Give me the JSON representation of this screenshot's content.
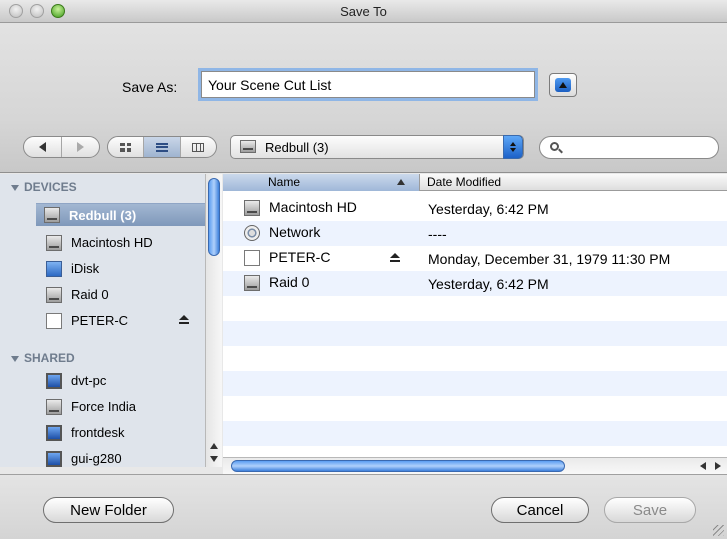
{
  "window": {
    "title": "Save To"
  },
  "save": {
    "label": "Save As:",
    "filename": "Your Scene Cut List"
  },
  "location": {
    "selected": "Redbull (3)"
  },
  "sidebar": {
    "devices_heading": "DEVICES",
    "devices": [
      {
        "label": "Redbull (3)",
        "icon": "hard-drive-icon",
        "selected": true
      },
      {
        "label": "Macintosh HD",
        "icon": "hard-drive-icon"
      },
      {
        "label": "iDisk",
        "icon": "idisk-icon"
      },
      {
        "label": "Raid 0",
        "icon": "hard-drive-icon"
      },
      {
        "label": "PETER-C",
        "icon": "volume-icon",
        "eject": true
      }
    ],
    "shared_heading": "SHARED",
    "shared": [
      {
        "label": "dvt-pc",
        "icon": "computer-icon"
      },
      {
        "label": "Force India",
        "icon": "hard-drive-icon"
      },
      {
        "label": "frontdesk",
        "icon": "computer-icon"
      },
      {
        "label": "gui-g280",
        "icon": "computer-icon"
      }
    ]
  },
  "files": {
    "columns": {
      "name": "Name",
      "date": "Date Modified"
    },
    "rows": [
      {
        "name": "Macintosh HD",
        "date": "Yesterday, 6:42 PM",
        "icon": "hard-drive-icon"
      },
      {
        "name": "Network",
        "date": "----",
        "icon": "network-icon"
      },
      {
        "name": "PETER-C",
        "date": "Monday, December 31, 1979 11:30 PM",
        "icon": "volume-icon",
        "eject": true
      },
      {
        "name": "Raid 0",
        "date": "Yesterday, 6:42 PM",
        "icon": "hard-drive-icon"
      }
    ]
  },
  "buttons": {
    "new_folder": "New Folder",
    "cancel": "Cancel",
    "save": "Save"
  }
}
